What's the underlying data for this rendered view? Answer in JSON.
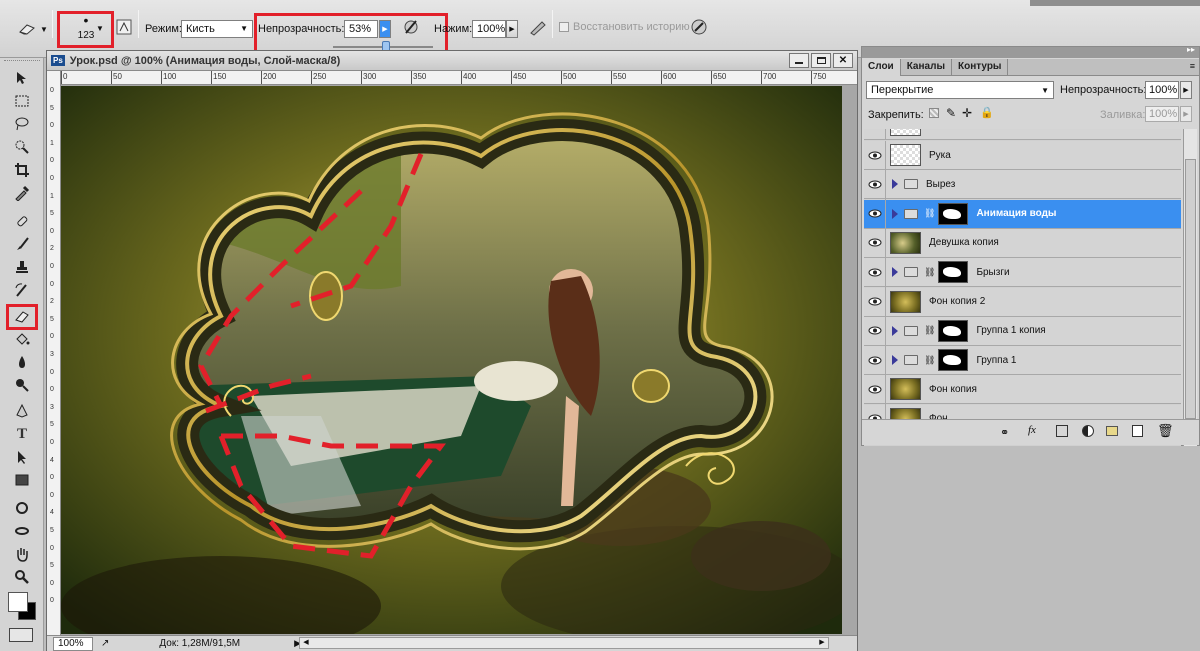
{
  "options_bar": {
    "brush_size": "123",
    "mode_label": "Режим:",
    "mode_value": "Кисть",
    "opacity_label": "Непрозрачность:",
    "opacity_value": "53%",
    "opacity_slider_percent": 53,
    "flow_label": "Нажим:",
    "flow_value": "100%",
    "restore_history_label": "Восстановить историю",
    "restore_history_checked": false
  },
  "document": {
    "title": "Урок.psd @ 100% (Анимация воды, Слой-маска/8)",
    "ruler_marks": [
      "0",
      "50",
      "100",
      "150",
      "200",
      "250",
      "300",
      "350",
      "400",
      "450",
      "500",
      "550",
      "600",
      "650",
      "700",
      "750"
    ],
    "ruler_left_marks": [
      "0",
      "5",
      "0",
      "1",
      "0",
      "0",
      "1",
      "5",
      "0",
      "2",
      "0",
      "0",
      "2",
      "5",
      "0",
      "3",
      "0",
      "0",
      "3",
      "5",
      "0",
      "4",
      "0",
      "0",
      "4",
      "5",
      "0",
      "5",
      "0",
      "0"
    ],
    "zoom": "100%",
    "doc_info": "Док: 1,28M/91,5M"
  },
  "layers_panel": {
    "tabs": [
      "Слои",
      "Каналы",
      "Контуры"
    ],
    "blend_mode": "Перекрытие",
    "opacity_label": "Непрозрачность:",
    "opacity_value": "100%",
    "lock_label": "Закрепить:",
    "fill_label": "Заливка:",
    "fill_value": "100%",
    "layers": [
      {
        "name": "Рука",
        "kind": "transparent"
      },
      {
        "name": "Вырез",
        "kind": "group"
      },
      {
        "name": "Анимация воды",
        "kind": "group-mask",
        "selected": true
      },
      {
        "name": "Девушка копия",
        "kind": "image"
      },
      {
        "name": "Брызги",
        "kind": "group-mask"
      },
      {
        "name": "Фон копия 2",
        "kind": "texture"
      },
      {
        "name": "Группа 1 копия",
        "kind": "group-mask"
      },
      {
        "name": "Группа 1",
        "kind": "group-mask"
      },
      {
        "name": "Фон копия",
        "kind": "texture"
      },
      {
        "name": "Фон",
        "kind": "texture"
      }
    ]
  },
  "colors": {
    "accent_red": "#e2202a",
    "selection_blue": "#3a8ff0"
  }
}
